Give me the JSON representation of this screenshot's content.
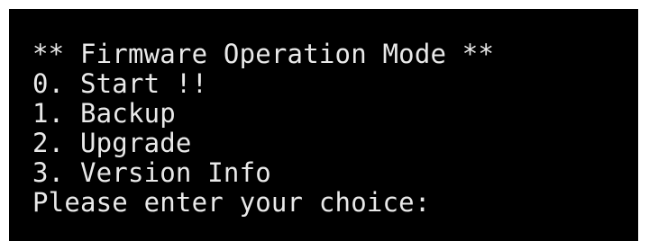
{
  "terminal": {
    "background_color": "#000000",
    "text_color": "#e9e9e9",
    "title_line": "** Firmware Operation Mode **",
    "menu": [
      {
        "label": "0. Start !!"
      },
      {
        "label": "1. Backup"
      },
      {
        "label": "2. Upgrade"
      },
      {
        "label": "3. Version Info"
      }
    ],
    "prompt": "Please enter your choice:",
    "input_value": ""
  }
}
